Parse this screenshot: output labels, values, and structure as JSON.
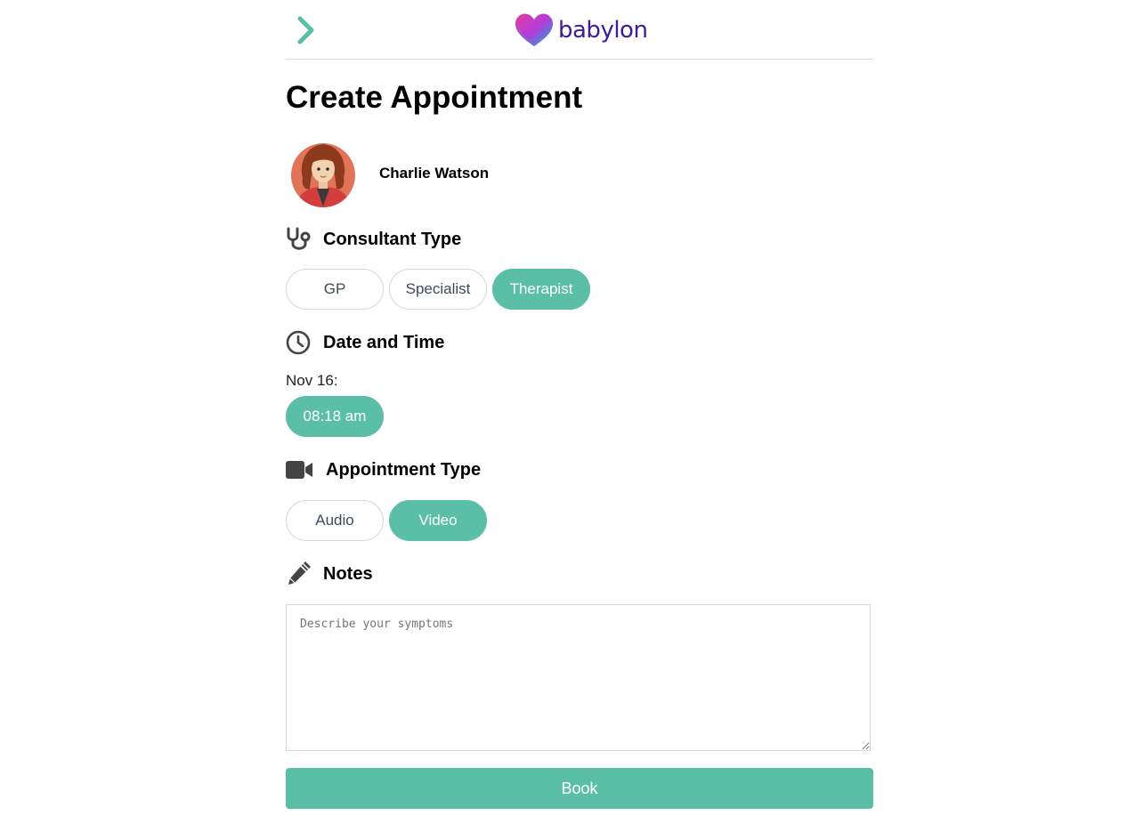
{
  "header": {
    "back_icon": "chevron-right-icon",
    "logo_text": "babylon",
    "colors": {
      "logo_text": "#3d1c97",
      "back": "#5bbfa8"
    }
  },
  "page_title": "Create Appointment",
  "profile": {
    "name": "Charlie Watson",
    "avatar_icon": "woman-avatar"
  },
  "consultant": {
    "heading": "Consultant Type",
    "icon": "stethoscope-icon",
    "options": [
      "GP",
      "Specialist",
      "Therapist"
    ],
    "selected": "Therapist"
  },
  "datetime": {
    "heading": "Date and Time",
    "icon": "clock-icon",
    "date_label": "Nov 16:",
    "slots": [
      "08:18 am"
    ],
    "selected": "08:18 am"
  },
  "appointment": {
    "heading": "Appointment Type",
    "icon": "video-camera-icon",
    "options": [
      "Audio",
      "Video"
    ],
    "selected": "Video"
  },
  "notes": {
    "heading": "Notes",
    "icon": "pencil-icon",
    "placeholder": "Describe your symptoms",
    "value": ""
  },
  "book_label": "Book",
  "colors": {
    "accent": "#5bbfa8",
    "border": "#d9d9d9",
    "pill_text": "#3f4a5a"
  }
}
